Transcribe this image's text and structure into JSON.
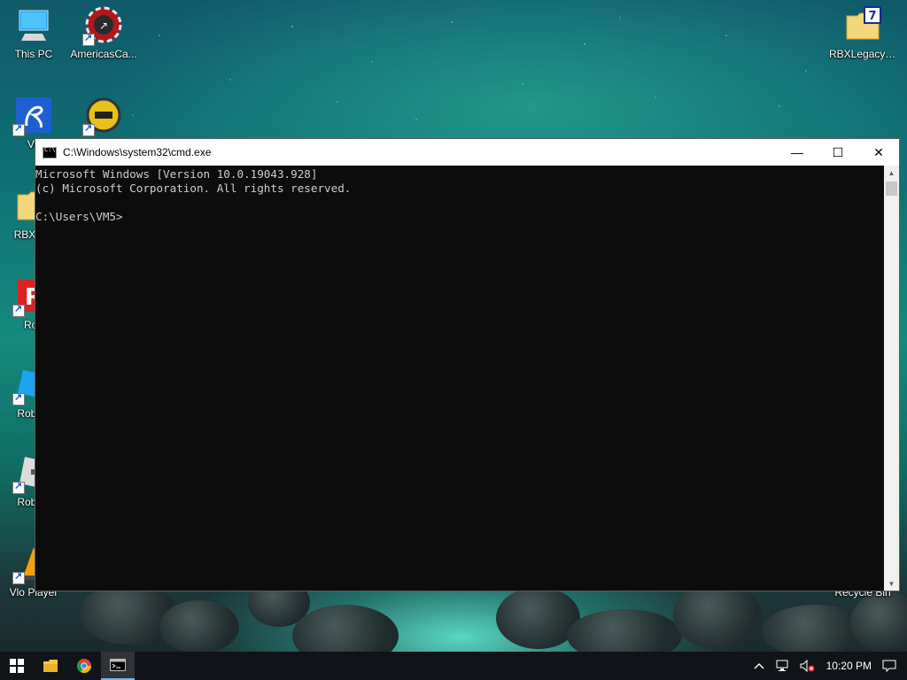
{
  "desktop": {
    "icons": [
      {
        "label": "This PC"
      },
      {
        "label": "AmericasCa..."
      },
      {
        "label": "RBXLegacy_..."
      },
      {
        "label": "Vu"
      },
      {
        "label": "RBXLeg"
      },
      {
        "label": "Rob"
      },
      {
        "label": "Roblox"
      },
      {
        "label": "Roblox"
      },
      {
        "label": "Vlo Player"
      },
      {
        "label": "Recycle Bin"
      }
    ]
  },
  "window": {
    "title": "C:\\Windows\\system32\\cmd.exe",
    "icon": "cmd-icon",
    "controls": {
      "minimize": "—",
      "maximize": "☐",
      "close": "✕"
    },
    "terminal_lines": [
      "Microsoft Windows [Version 10.0.19043.928]",
      "(c) Microsoft Corporation. All rights reserved.",
      "",
      "C:\\Users\\VM5>"
    ]
  },
  "taskbar": {
    "clock": "10:20 PM",
    "items": [
      "start-icon",
      "file-explorer-icon",
      "chrome-icon",
      "cmd-icon"
    ]
  },
  "colors": {
    "terminal_bg": "#0c0c0c",
    "terminal_fg": "#cccccc",
    "taskbar_bg": "#101418"
  }
}
